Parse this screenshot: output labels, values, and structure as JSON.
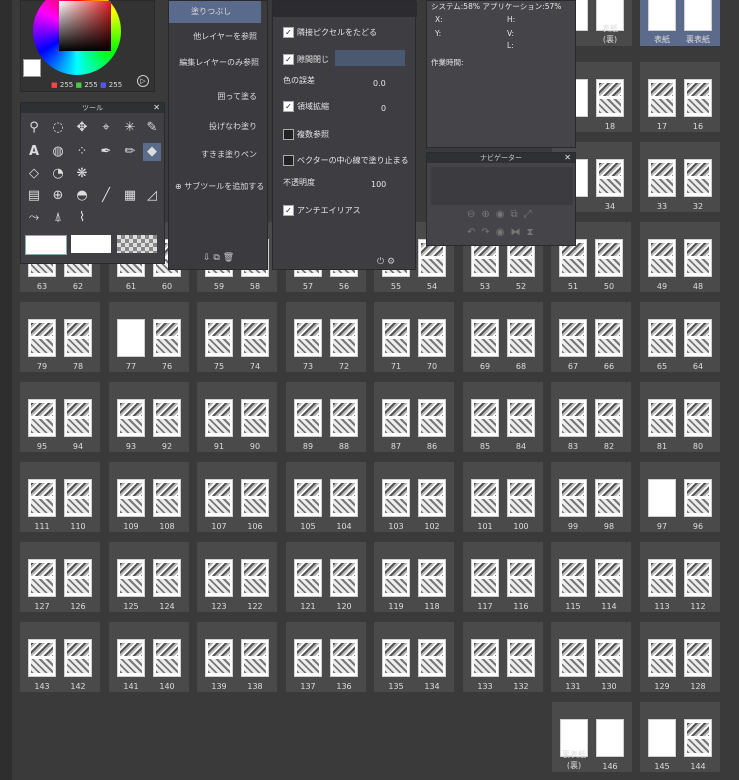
{
  "color": {
    "r": "255",
    "g": "255",
    "b": "255"
  },
  "tool_palette": {
    "title": "ツール"
  },
  "subtools": [
    {
      "label": "塗りつぶし"
    },
    {
      "label": "他レイヤーを参照"
    },
    {
      "label": "編集レイヤーのみ参照"
    },
    {
      "label": "囲って塗る"
    },
    {
      "label": "投げなわ塗り"
    },
    {
      "label": "すきま塗りペン"
    }
  ],
  "add_subtool": "サブツールを追加する",
  "props": {
    "adjacent": "隣接ピクセルをたどる",
    "close_gap": "隙間閉じ",
    "color_margin": "色の誤差",
    "color_margin_value": "0.0",
    "area_scaling": "領域拡縮",
    "area_scaling_value": "0",
    "multi_ref": "複数参照",
    "vector_center": "ベクターの中心線で塗り止まる",
    "opacity": "不透明度",
    "opacity_value": "100",
    "antialias": "アンチエイリアス"
  },
  "info": {
    "system": "システム:58% アプリケーション:57%",
    "x": "X:",
    "y": "Y:",
    "h": "H:",
    "v": "V:",
    "l": "L:",
    "work_time": "作業時間:"
  },
  "navigator": {
    "title": "ナビゲーター"
  },
  "top_row": [
    {
      "label": "表紙(裏)"
    },
    {
      "label": "表紙"
    },
    {
      "label": "裏表紙"
    }
  ],
  "rows": [
    [
      "18",
      "17",
      "16"
    ],
    [
      "34",
      "33",
      "32"
    ],
    [
      "63",
      "62",
      "61",
      "60",
      "59",
      "58",
      "57",
      "56",
      "55",
      "54",
      "53",
      "52",
      "51",
      "50",
      "49",
      "48"
    ],
    [
      "79",
      "78",
      "77",
      "76",
      "75",
      "74",
      "73",
      "72",
      "71",
      "70",
      "69",
      "68",
      "67",
      "66",
      "65",
      "64"
    ],
    [
      "95",
      "94",
      "93",
      "92",
      "91",
      "90",
      "89",
      "88",
      "87",
      "86",
      "85",
      "84",
      "83",
      "82",
      "81",
      "80"
    ],
    [
      "111",
      "110",
      "109",
      "108",
      "107",
      "106",
      "105",
      "104",
      "103",
      "102",
      "101",
      "100",
      "99",
      "98",
      "97",
      "96"
    ],
    [
      "127",
      "126",
      "125",
      "124",
      "123",
      "122",
      "121",
      "120",
      "119",
      "118",
      "117",
      "116",
      "115",
      "114",
      "113",
      "112"
    ],
    [
      "143",
      "142",
      "141",
      "140",
      "139",
      "138",
      "137",
      "136",
      "135",
      "134",
      "133",
      "132",
      "131",
      "130",
      "129",
      "128"
    ]
  ],
  "last_row": [
    {
      "l": "裏表紙(裏)",
      "r": "146"
    },
    {
      "l": "145",
      "r": "144"
    }
  ]
}
